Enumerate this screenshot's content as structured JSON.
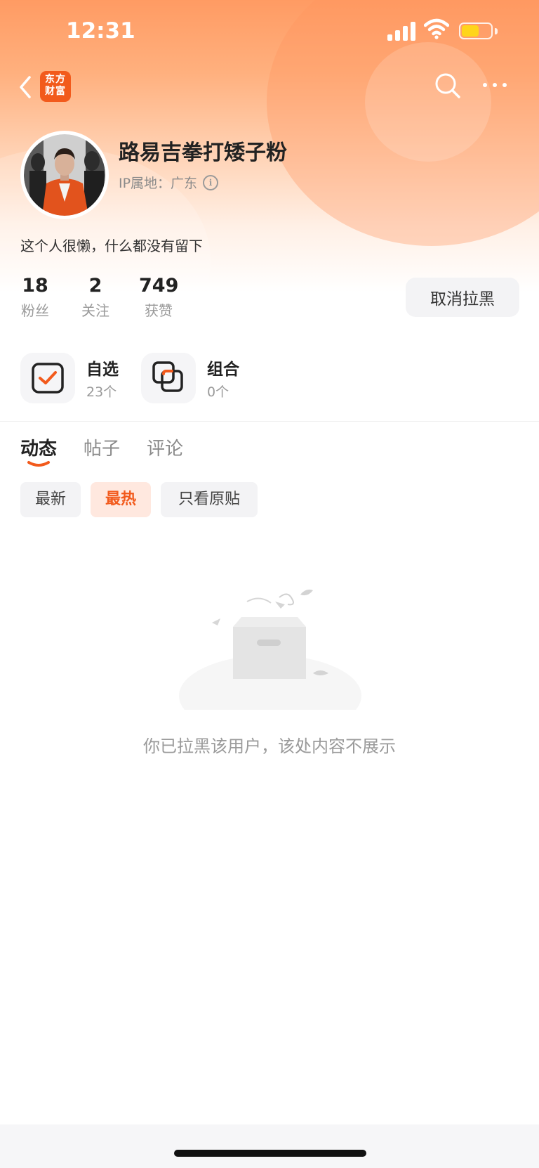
{
  "status_bar": {
    "time": "12:31"
  },
  "nav": {
    "logo_line1": "东方",
    "logo_line2": "财富"
  },
  "profile": {
    "name": "路易吉拳打矮子粉",
    "ip_label": "IP属地：广东",
    "bio": "这个人很懒，什么都没有留下",
    "stats": [
      {
        "value": "18",
        "label": "粉丝"
      },
      {
        "value": "2",
        "label": "关注"
      },
      {
        "value": "749",
        "label": "获赞"
      }
    ],
    "unblock_button": "取消拉黑"
  },
  "portfolio": {
    "watchlist": {
      "label": "自选",
      "count": "23个"
    },
    "combo": {
      "label": "组合",
      "count": "0个"
    }
  },
  "tabs": [
    {
      "label": "动态",
      "active": true
    },
    {
      "label": "帖子",
      "active": false
    },
    {
      "label": "评论",
      "active": false
    }
  ],
  "filters": [
    {
      "label": "最新",
      "active": false
    },
    {
      "label": "最热",
      "active": true
    },
    {
      "label": "只看原贴",
      "active": false
    }
  ],
  "empty_state": {
    "message": "你已拉黑该用户，该处内容不展示"
  },
  "colors": {
    "accent": "#f25a1c",
    "header_gradient_top": "#ff9b63",
    "battery": "#ffd51a"
  }
}
